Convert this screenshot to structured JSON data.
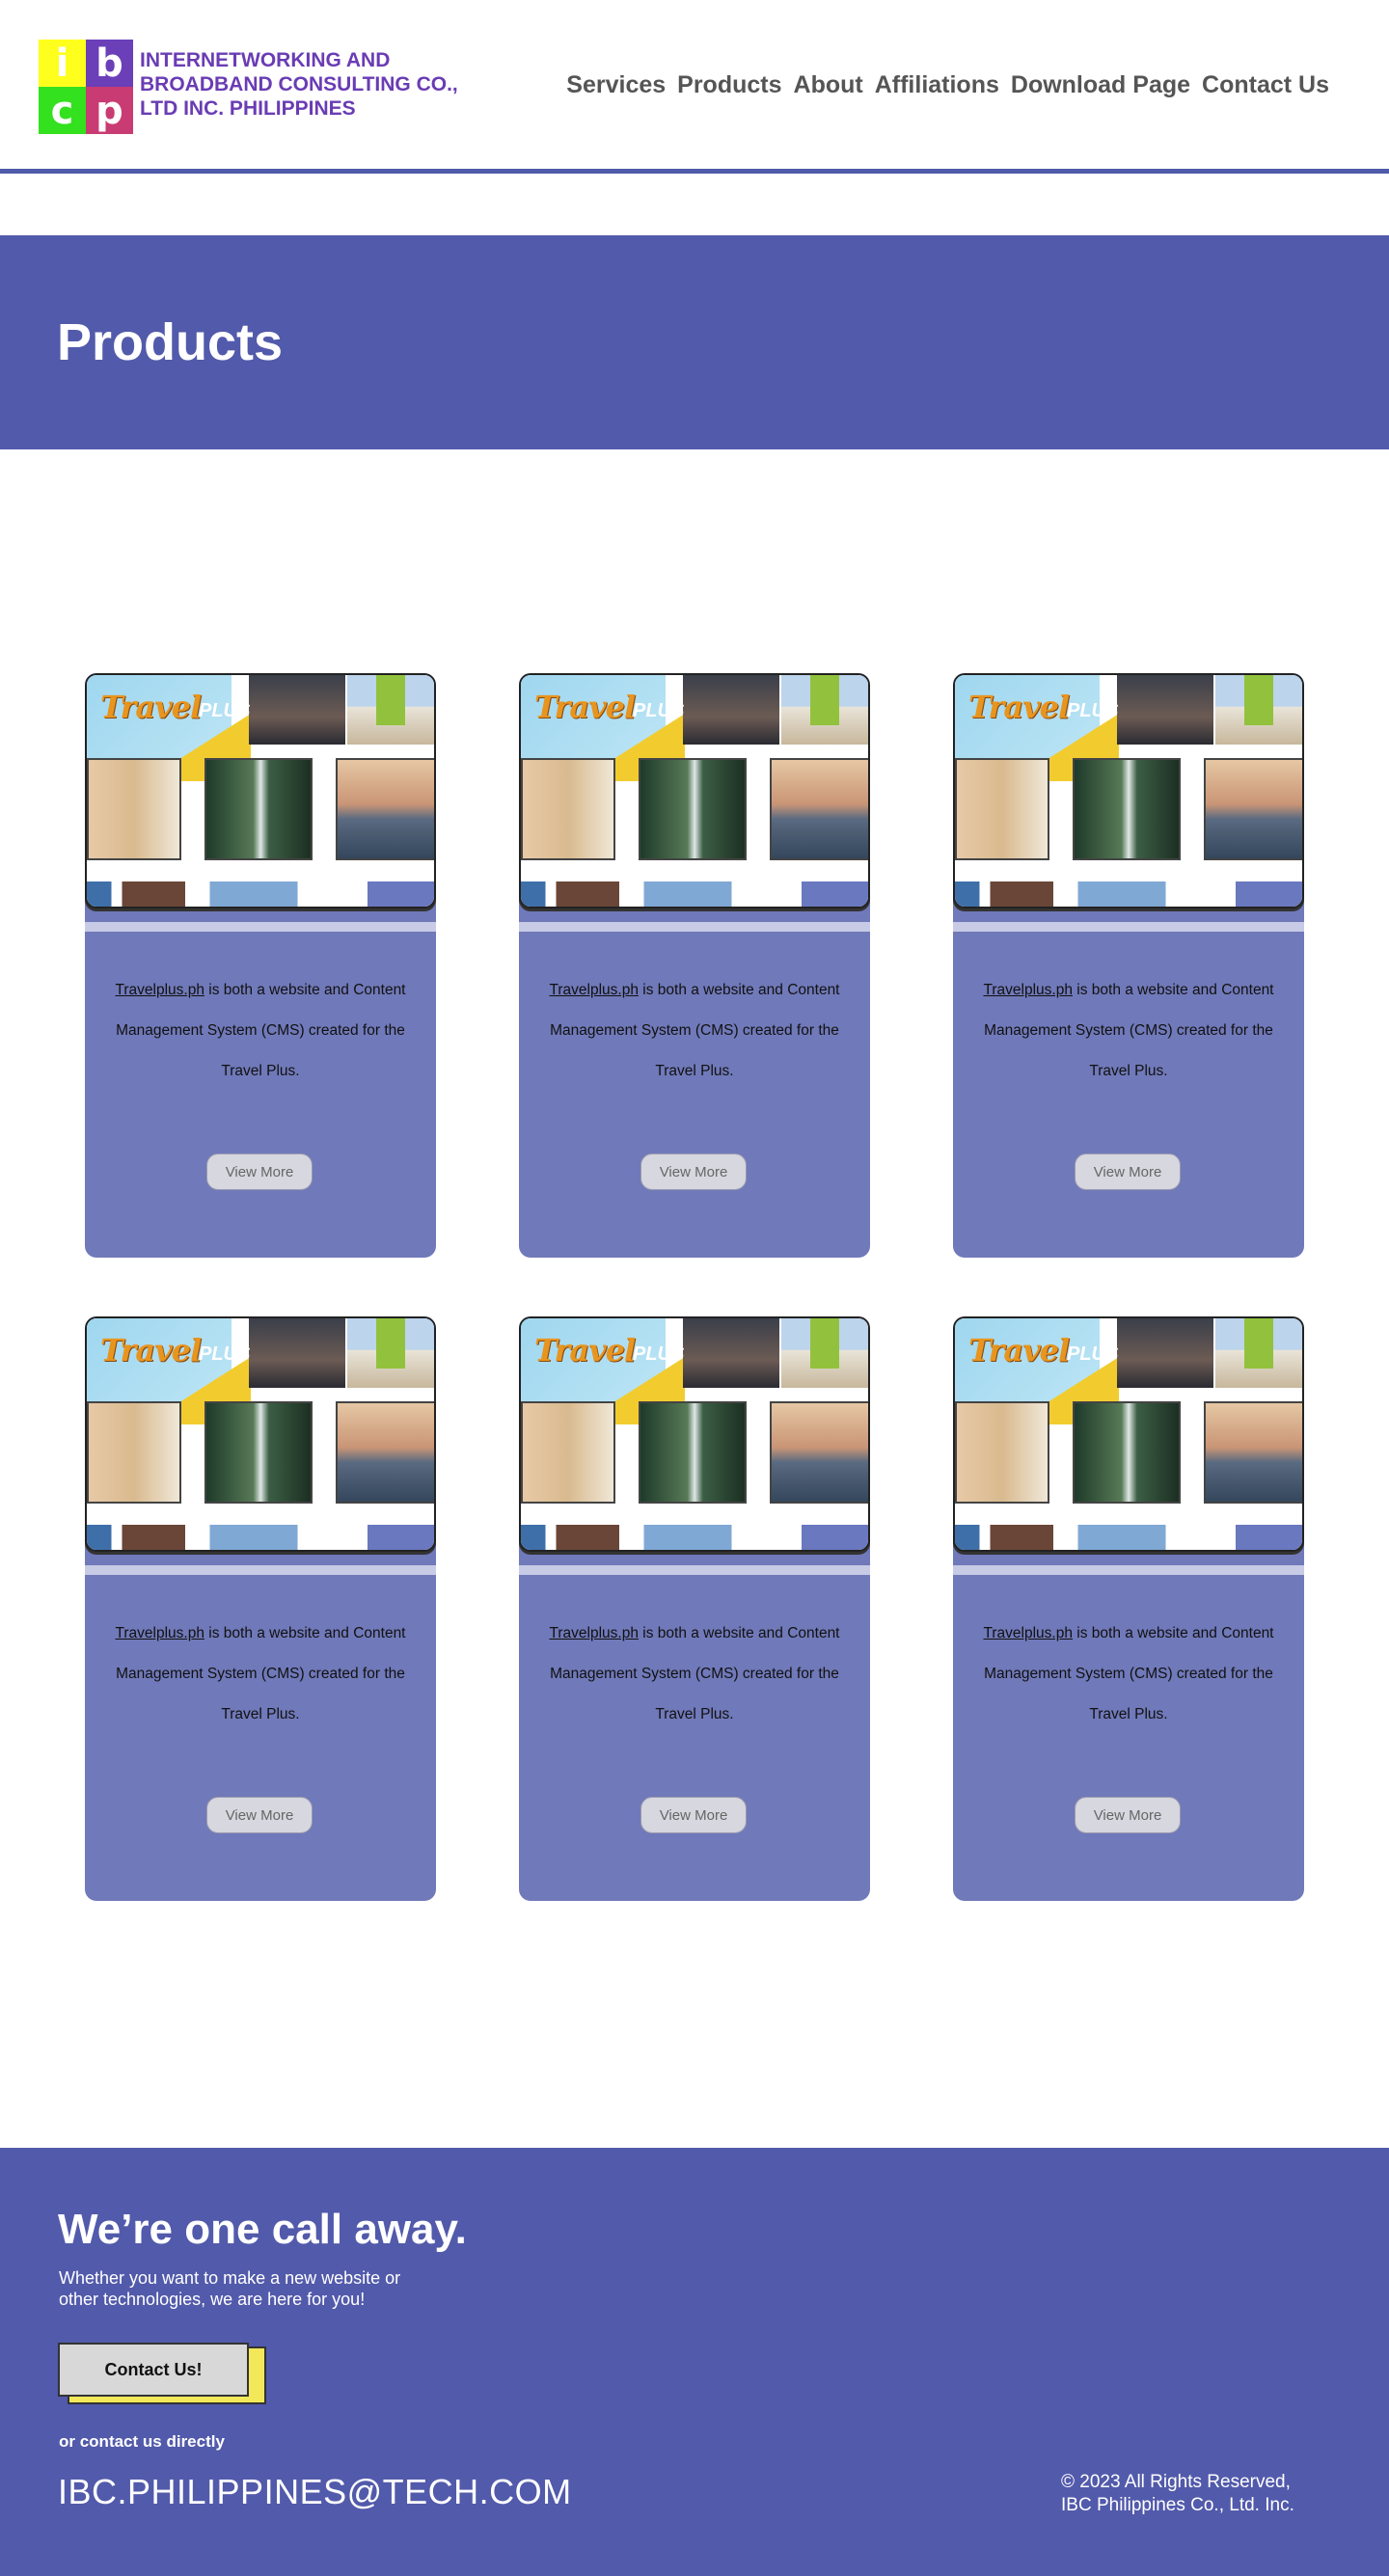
{
  "header": {
    "logo_letters": [
      "i",
      "b",
      "c",
      "p"
    ],
    "company_name": "INTERNETWORKING AND BROADBAND CONSULTING CO., LTD INC. PHILIPPINES",
    "nav": [
      "Services",
      "Products",
      "About",
      "Affiliations",
      "Download Page",
      "Contact Us"
    ]
  },
  "hero": {
    "title": "Products"
  },
  "cards": [
    {
      "brand": "Travel",
      "brand_plus": "PLUS",
      "link_text": "Travelplus.ph",
      "desc_rest": " is both a website and Content Management System (CMS) created for the Travel Plus.",
      "button": "View More"
    },
    {
      "brand": "Travel",
      "brand_plus": "PLUS",
      "link_text": "Travelplus.ph",
      "desc_rest": " is both a website and Content Management System (CMS) created for the Travel Plus.",
      "button": "View More"
    },
    {
      "brand": "Travel",
      "brand_plus": "PLUS",
      "link_text": "Travelplus.ph",
      "desc_rest": " is both a website and Content Management System (CMS) created for the Travel Plus.",
      "button": "View More"
    },
    {
      "brand": "Travel",
      "brand_plus": "PLUS",
      "link_text": "Travelplus.ph",
      "desc_rest": " is both a website and Content Management System (CMS) created for the Travel Plus.",
      "button": "View More"
    },
    {
      "brand": "Travel",
      "brand_plus": "PLUS",
      "link_text": "Travelplus.ph",
      "desc_rest": " is both a website and Content Management System (CMS) created for the Travel Plus.",
      "button": "View More"
    },
    {
      "brand": "Travel",
      "brand_plus": "PLUS",
      "link_text": "Travelplus.ph",
      "desc_rest": " is both a website and Content Management System (CMS) created for the Travel Plus.",
      "button": "View More"
    }
  ],
  "footer": {
    "heading": "We’re one call away.",
    "subtext": "Whether you want to make a new website or other technologies, we are here for you!",
    "cta": "Contact Us!",
    "or_text": "or contact us directly",
    "email": "IBC.PHILIPPINES@TECH.COM",
    "copyright_line1": "© 2023 All Rights Reserved,",
    "copyright_line2": "IBC Philippines Co., Ltd. Inc."
  },
  "colors": {
    "brand_purple": "#525aab",
    "card_bg": "#7079b9",
    "accent_yellow": "#f2e85a"
  }
}
